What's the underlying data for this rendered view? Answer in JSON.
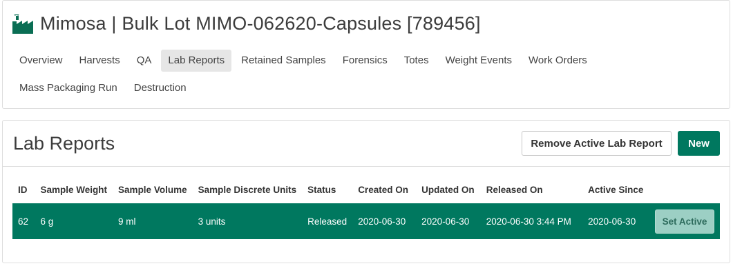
{
  "header": {
    "title": "Mimosa | Bulk Lot MIMO-062620-Capsules [789456]",
    "icon": "factory-icon",
    "icon_color": "#0a6e54"
  },
  "tabs": [
    {
      "label": "Overview",
      "active": false
    },
    {
      "label": "Harvests",
      "active": false
    },
    {
      "label": "QA",
      "active": false
    },
    {
      "label": "Lab Reports",
      "active": true
    },
    {
      "label": "Retained Samples",
      "active": false
    },
    {
      "label": "Forensics",
      "active": false
    },
    {
      "label": "Totes",
      "active": false
    },
    {
      "label": "Weight Events",
      "active": false
    },
    {
      "label": "Work Orders",
      "active": false
    },
    {
      "label": "Mass Packaging Run",
      "active": false
    },
    {
      "label": "Destruction",
      "active": false
    }
  ],
  "lab_reports": {
    "title": "Lab Reports",
    "remove_button": "Remove Active Lab Report",
    "new_button": "New",
    "columns": [
      "ID",
      "Sample Weight",
      "Sample Volume",
      "Sample Discrete Units",
      "Status",
      "Created On",
      "Updated On",
      "Released On",
      "Active Since",
      ""
    ],
    "rows": [
      {
        "id": "62",
        "sample_weight": "6 g",
        "sample_volume": "9 ml",
        "sample_discrete_units": "3 units",
        "status": "Released",
        "created_on": "2020-06-30",
        "updated_on": "2020-06-30",
        "released_on": "2020-06-30 3:44 PM",
        "active_since": "2020-06-30",
        "action": "Set Active"
      }
    ]
  },
  "colors": {
    "accent": "#00785f",
    "row_highlight": "#00785f",
    "set_active_bg": "#9ccfc4"
  }
}
